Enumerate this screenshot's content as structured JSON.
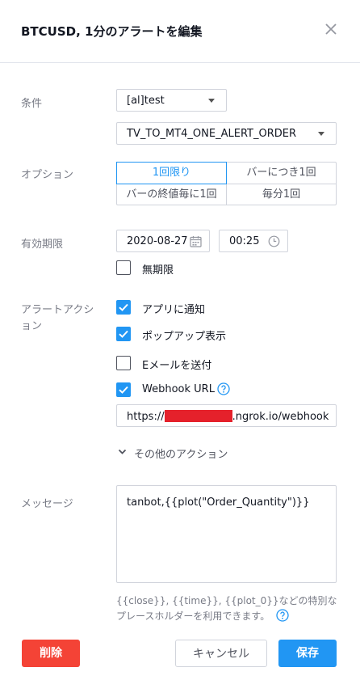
{
  "dialog": {
    "title": "BTCUSD, 1分のアラートを編集"
  },
  "condition": {
    "label": "条件",
    "primary": "[al]test",
    "secondary": "TV_TO_MT4_ONE_ALERT_ORDER"
  },
  "options": {
    "label": "オプション",
    "items": [
      "1回限り",
      "バーにつき1回",
      "バーの終値毎に1回",
      "毎分1回"
    ],
    "selected": "1回限り"
  },
  "expiration": {
    "label": "有効期限",
    "date": "2020-08-27",
    "time": "00:25",
    "unlimited_label": "無期限",
    "unlimited_checked": false
  },
  "actions": {
    "label_line1": "アラートアクシ",
    "label_line2": "ョン",
    "notify_app": {
      "label": "アプリに通知",
      "checked": true
    },
    "popup": {
      "label": "ポップアップ表示",
      "checked": true
    },
    "email": {
      "label": "Eメールを送付",
      "checked": false
    },
    "webhook": {
      "label": "Webhook URL",
      "checked": true
    },
    "webhook_url_prefix": "https://",
    "webhook_url_suffix": ".ngrok.io/webhook",
    "more_label": "その他のアクション"
  },
  "message": {
    "label": "メッセージ",
    "text": "tanbot,{{plot(\"Order_Quantity\")}}",
    "hint": "{{close}}, {{time}}, {{plot_0}}などの特別なプレースホルダーを利用できます。"
  },
  "buttons": {
    "delete": "削除",
    "cancel": "キャンセル",
    "save": "保存"
  },
  "colors": {
    "accent": "#2196f3",
    "danger": "#f44336"
  }
}
